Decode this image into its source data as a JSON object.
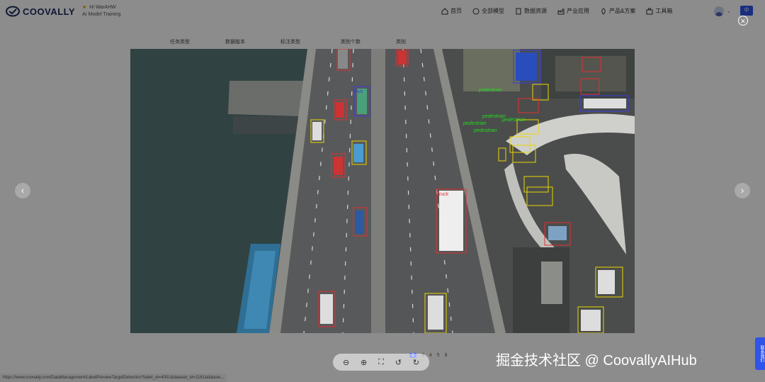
{
  "header": {
    "brand": "COOVALLY",
    "project_line1": "Hi  WarAHW",
    "project_line2": "AI Model Training",
    "nav": [
      "首页",
      "全部模型",
      "数据资源",
      "产业应用",
      "产品&方案",
      "工具箱"
    ],
    "lang_label": "中"
  },
  "dataset_columns": [
    "任务类型",
    "数据版本",
    "标注类型",
    "类别个数",
    "类别"
  ],
  "viewer": {
    "labels": {
      "bus": "bus",
      "truck": "truck",
      "car": "car",
      "pedestrian": "pedestrian"
    },
    "colors": {
      "car": "#e03030",
      "van": "#e8d800",
      "bus": "#3a3ae0",
      "truck": "#e03030",
      "pedestrian": "#22dd22"
    }
  },
  "toolbar": {
    "icons": [
      "zoom-out-icon",
      "zoom-in-icon",
      "fit-screen-icon",
      "rotate-left-icon",
      "rotate-right-icon"
    ]
  },
  "pager": [
    "1",
    "3",
    "4",
    "5",
    "6"
  ],
  "statusbar": "https://www.coovally.com/DataManagement/LabelPreviewTargetDetection?label_id=4001&dataset_id=2161&datase...",
  "watermark": "掘金技术社区 @ CoovallyAIHub",
  "side_button": "联系我们"
}
